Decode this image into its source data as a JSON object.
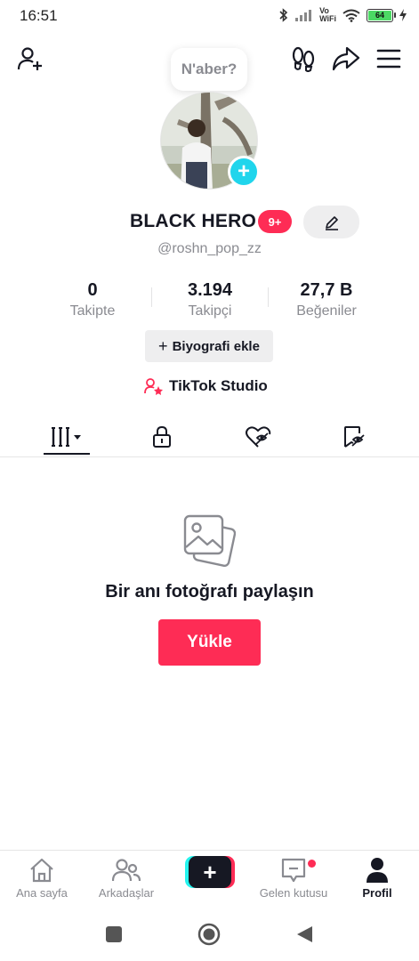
{
  "status_bar": {
    "time": "16:51",
    "network_label_top": "Vo",
    "network_label_bottom": "WiFi",
    "battery": "64",
    "icons": [
      "bluetooth-icon",
      "signal-icon",
      "wifi-icon",
      "battery-icon",
      "charging-icon"
    ]
  },
  "top_bar": {
    "icons": [
      "add-friend-icon",
      "footprint-icon",
      "share-icon",
      "menu-icon"
    ]
  },
  "profile": {
    "note": "N'aber?",
    "display_name": "BLACK HERO",
    "notification_badge": "9+",
    "username": "@roshn_pop_zz"
  },
  "stats": [
    {
      "value": "0",
      "label": "Takipte"
    },
    {
      "value": "3.194",
      "label": "Takipçi"
    },
    {
      "value": "27,7 B",
      "label": "Beğeniler"
    }
  ],
  "bio_button": {
    "label": "Biyografi ekle",
    "prefix": "+"
  },
  "studio_link": {
    "label": "TikTok Studio"
  },
  "tabs": [
    "videos-grid-icon",
    "lock-icon",
    "liked-hidden-icon",
    "saved-hidden-icon"
  ],
  "empty_state": {
    "title": "Bir anı fotoğrafı paylaşın",
    "button": "Yükle"
  },
  "bottom_nav": {
    "items": [
      {
        "label": "Ana sayfa",
        "icon": "home-icon"
      },
      {
        "label": "Arkadaşlar",
        "icon": "friends-icon"
      },
      {
        "label": "",
        "icon": "create-icon"
      },
      {
        "label": "Gelen kutusu",
        "icon": "inbox-icon"
      },
      {
        "label": "Profil",
        "icon": "profile-icon"
      }
    ],
    "create_symbol": "+"
  },
  "colors": {
    "accent": "#fe2c55",
    "cyan": "#20d5ec",
    "text": "#161823",
    "muted": "#8a8b91"
  }
}
